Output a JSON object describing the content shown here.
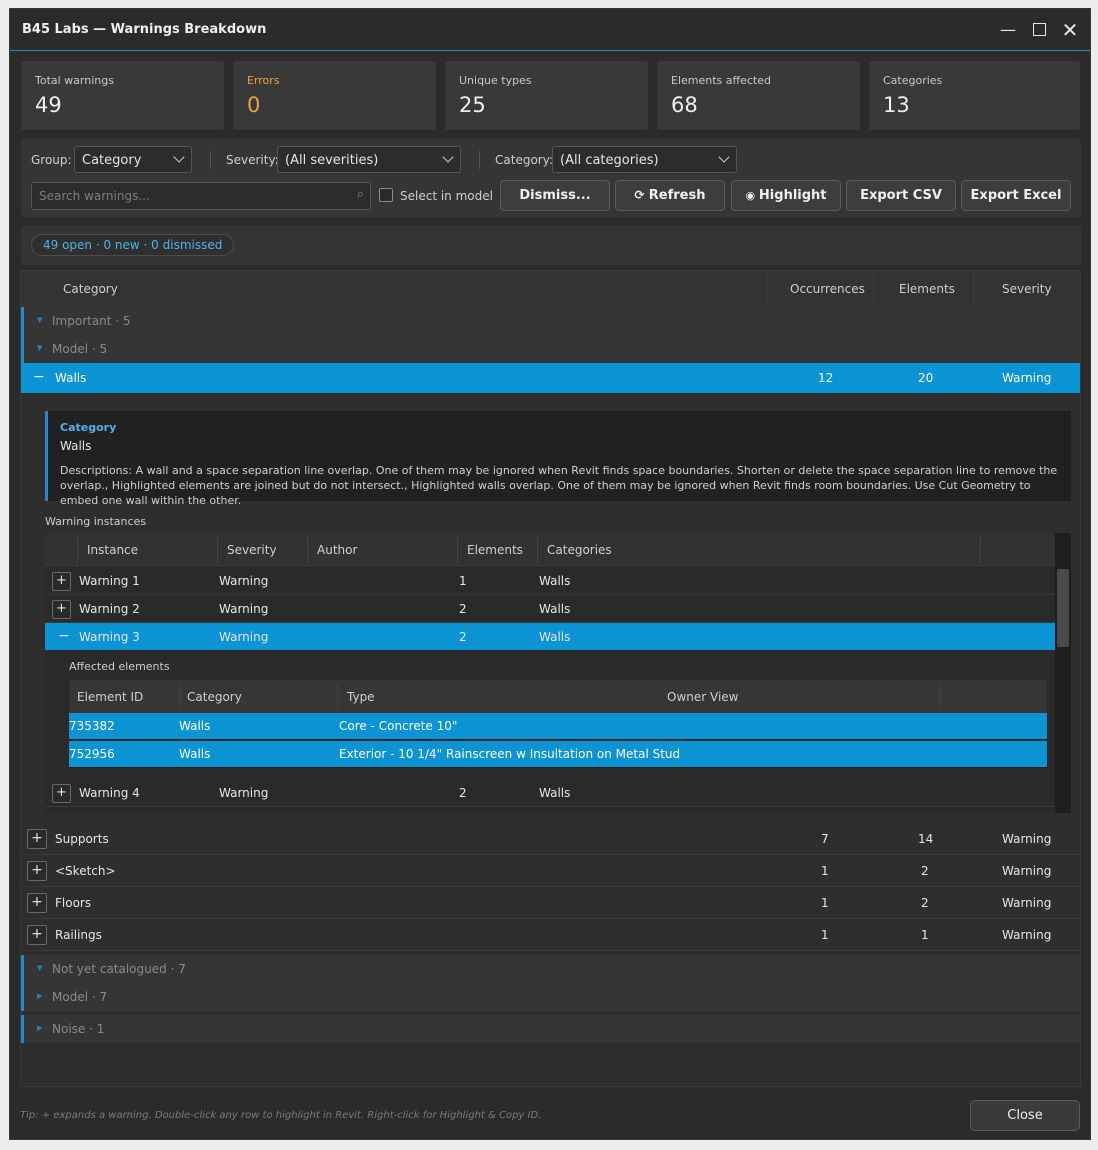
{
  "window": {
    "title": "B45 Labs — Warnings Breakdown"
  },
  "kpis": [
    {
      "label": "Total warnings",
      "value": "49"
    },
    {
      "label": "Errors",
      "value": "0"
    },
    {
      "label": "Unique types",
      "value": "25"
    },
    {
      "label": "Elements affected",
      "value": "68"
    },
    {
      "label": "Categories",
      "value": "13"
    }
  ],
  "toolbar": {
    "group_label": "Group:",
    "group_value": "Category",
    "severity_label": "Severity:",
    "severity_value": "(All severities)",
    "category_label": "Category:",
    "category_value": "(All categories)",
    "search_placeholder": "Search warnings...",
    "select_in_model": "Select in model",
    "dismiss": "Dismiss...",
    "refresh": "Refresh",
    "highlight": "Highlight",
    "export_csv": "Export CSV",
    "export_excel": "Export Excel"
  },
  "status": {
    "text": "49 open · 0 new · 0 dismissed"
  },
  "grid": {
    "headers": {
      "category": "Category",
      "occurrences": "Occurrences",
      "elements": "Elements",
      "severity": "Severity"
    },
    "groups_top": [
      "Important · 5",
      "Model · 5"
    ],
    "selected": {
      "name": "Walls",
      "occurrences": "12",
      "elements": "20",
      "severity": "Warning"
    },
    "detail": {
      "label": "Category",
      "value": "Walls",
      "desc_label": "Descriptions:",
      "desc": "A wall and a space separation line overlap. One of them may be ignored when Revit finds space boundaries. Shorten or delete the space separation line to remove the overlap., Highlighted elements are joined but do not intersect., Highlighted walls overlap. One of them may be ignored when Revit finds room boundaries. Use Cut Geometry to embed one wall within the other."
    },
    "instances": {
      "label": "Warning instances",
      "headers": {
        "instance": "Instance",
        "severity": "Severity",
        "author": "Author",
        "elements": "Elements",
        "categories": "Categories"
      },
      "rows": [
        {
          "name": "Warning 1",
          "severity": "Warning",
          "author": "",
          "elements": "1",
          "categories": "Walls"
        },
        {
          "name": "Warning 2",
          "severity": "Warning",
          "author": "",
          "elements": "2",
          "categories": "Walls"
        },
        {
          "name": "Warning 3",
          "severity": "Warning",
          "author": "",
          "elements": "2",
          "categories": "Walls"
        },
        {
          "name": "Warning 4",
          "severity": "Warning",
          "author": "",
          "elements": "2",
          "categories": "Walls"
        }
      ],
      "affected": {
        "label": "Affected elements",
        "headers": {
          "id": "Element ID",
          "category": "Category",
          "type": "Type",
          "owner": "Owner View"
        },
        "rows": [
          {
            "id": "735382",
            "category": "Walls",
            "type": "Core - Concrete 10\"",
            "owner": ""
          },
          {
            "id": "752956",
            "category": "Walls",
            "type": "Exterior - 10 1/4\" Rainscreen w Insultation on Metal Stud",
            "owner": ""
          }
        ]
      }
    },
    "other_rows": [
      {
        "name": "Supports",
        "occurrences": "7",
        "elements": "14",
        "severity": "Warning"
      },
      {
        "name": "<Sketch>",
        "occurrences": "1",
        "elements": "2",
        "severity": "Warning"
      },
      {
        "name": "Floors",
        "occurrences": "1",
        "elements": "2",
        "severity": "Warning"
      },
      {
        "name": "Railings",
        "occurrences": "1",
        "elements": "1",
        "severity": "Warning"
      }
    ],
    "groups_bottom": [
      "Not yet catalogued · 7",
      "Model · 7",
      "Noise · 1"
    ]
  },
  "footer": {
    "tip": "Tip: + expands a warning. Double-click any row to highlight in Revit. Right-click for Highlight & Copy ID.",
    "close": "Close"
  },
  "colors": {
    "accent": "#0a94d4",
    "errors": "#f0a040"
  }
}
